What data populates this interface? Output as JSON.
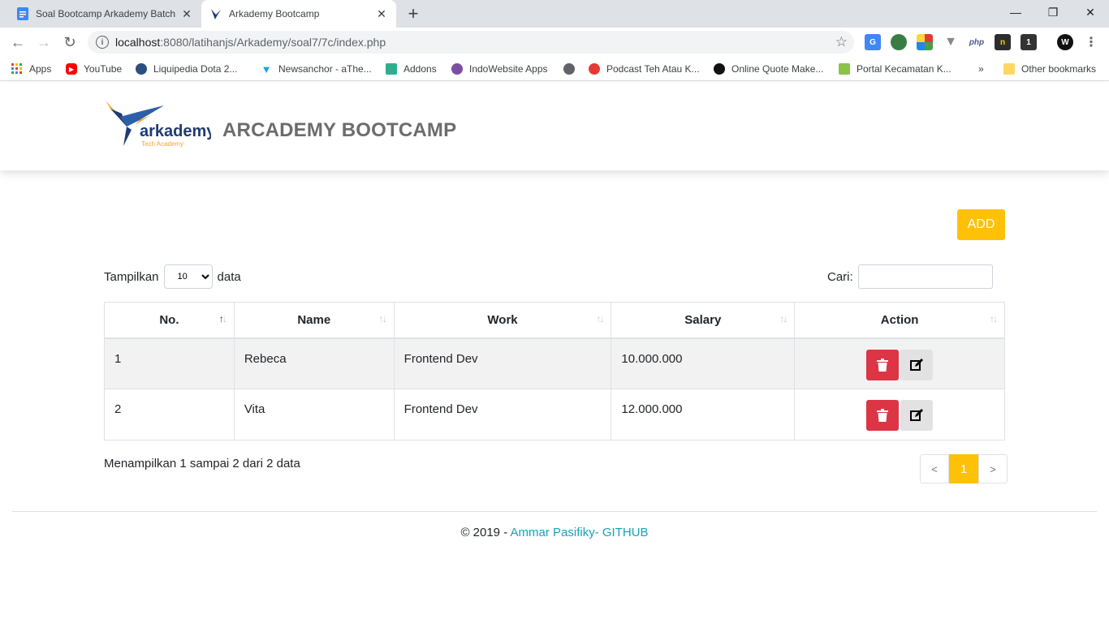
{
  "browser": {
    "tabs": [
      {
        "title": "Soal Bootcamp Arkademy Batch",
        "active": false
      },
      {
        "title": "Arkademy Bootcamp",
        "active": true
      }
    ],
    "address": {
      "host": "localhost",
      "path": ":8080/latihanjs/Arkademy/soal7/7c/index.php"
    },
    "bookmarks": [
      {
        "label": "Apps",
        "icon": "apps-grid-icon"
      },
      {
        "label": "YouTube",
        "icon": "youtube-icon"
      },
      {
        "label": "Liquipedia Dota 2...",
        "icon": "liquipedia-icon"
      },
      {
        "label": "Newsanchor - aThe...",
        "icon": "newsanchor-icon"
      },
      {
        "label": "Addons",
        "icon": "puzzle-icon"
      },
      {
        "label": "IndoWebsite Apps",
        "icon": "indowebsite-icon"
      },
      {
        "label": "",
        "icon": "globe-icon"
      },
      {
        "label": "Podcast Teh Atau K...",
        "icon": "podcast-icon"
      },
      {
        "label": "Online Quote Make...",
        "icon": "quote-icon"
      },
      {
        "label": "Portal Kecamatan K...",
        "icon": "portal-icon"
      },
      {
        "label": "Other bookmarks",
        "icon": "folder-icon"
      }
    ],
    "overflow_label": "»"
  },
  "header": {
    "logo_text": "arkademy",
    "logo_subtext": "Tech Academy",
    "brand": "ARCADEMY BOOTCAMP"
  },
  "controls": {
    "add_label": "ADD",
    "length_prefix": "Tampilkan",
    "length_value": "10",
    "length_suffix": "data",
    "search_label": "Cari:"
  },
  "table": {
    "columns": [
      "No.",
      "Name",
      "Work",
      "Salary",
      "Action"
    ],
    "rows": [
      {
        "no": "1",
        "name": "Rebeca",
        "work": "Frontend Dev",
        "salary": "10.000.000"
      },
      {
        "no": "2",
        "name": "Vita",
        "work": "Frontend Dev",
        "salary": "12.000.000"
      }
    ]
  },
  "pagination": {
    "info": "Menampilkan 1 sampai 2 dari 2 data",
    "prev": "<",
    "current": "1",
    "next": ">"
  },
  "footer": {
    "copyright": "© 2019 - ",
    "link_text": "Ammar Pasifiky- GITHUB"
  },
  "colors": {
    "accent": "#ffc107",
    "danger": "#dc3545",
    "link": "#17a2b8"
  }
}
